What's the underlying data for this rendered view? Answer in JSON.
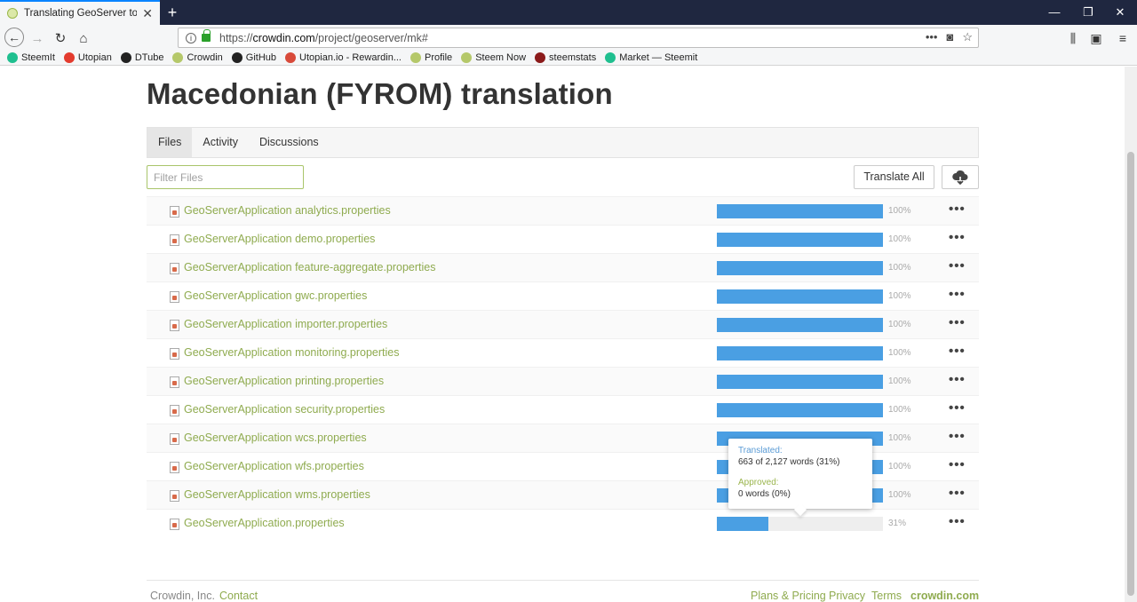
{
  "browser": {
    "tab_title": "Translating GeoServer to Maced",
    "url_domain": "crowdin.com",
    "url_path": "/project/geoserver/mk#",
    "url_prefix": "https://",
    "bookmarks": [
      {
        "label": "SteemIt",
        "color": "#1fbf8f"
      },
      {
        "label": "Utopian",
        "color": "#e33b2e"
      },
      {
        "label": "DTube",
        "color": "#222222"
      },
      {
        "label": "Crowdin",
        "color": "#b5c86a"
      },
      {
        "label": "GitHub",
        "color": "#222222"
      },
      {
        "label": "Utopian.io - Rewardin...",
        "color": "#d84a3a"
      },
      {
        "label": "Profile",
        "color": "#b5c86a"
      },
      {
        "label": "Steem Now",
        "color": "#b5c86a"
      },
      {
        "label": "steemstats",
        "color": "#8b1a1a"
      },
      {
        "label": "Market — Steemit",
        "color": "#1fbf8f"
      }
    ]
  },
  "page": {
    "title": "Macedonian (FYROM) translation",
    "tabs": [
      "Files",
      "Activity",
      "Discussions"
    ],
    "filter_placeholder": "Filter Files",
    "translate_all": "Translate All",
    "files": [
      {
        "name": "GeoServerApplication analytics.properties",
        "progress": 100,
        "pct": "100%"
      },
      {
        "name": "GeoServerApplication demo.properties",
        "progress": 100,
        "pct": "100%"
      },
      {
        "name": "GeoServerApplication feature-aggregate.properties",
        "progress": 100,
        "pct": "100%"
      },
      {
        "name": "GeoServerApplication gwc.properties",
        "progress": 100,
        "pct": "100%"
      },
      {
        "name": "GeoServerApplication importer.properties",
        "progress": 100,
        "pct": "100%"
      },
      {
        "name": "GeoServerApplication monitoring.properties",
        "progress": 100,
        "pct": "100%"
      },
      {
        "name": "GeoServerApplication printing.properties",
        "progress": 100,
        "pct": "100%"
      },
      {
        "name": "GeoServerApplication security.properties",
        "progress": 100,
        "pct": "100%"
      },
      {
        "name": "GeoServerApplication wcs.properties",
        "progress": 100,
        "pct": "100%"
      },
      {
        "name": "GeoServerApplication wfs.properties",
        "progress": 100,
        "pct": "100%"
      },
      {
        "name": "GeoServerApplication wms.properties",
        "progress": 100,
        "pct": "100%"
      },
      {
        "name": "GeoServerApplication.properties",
        "progress": 31,
        "pct": "31%"
      }
    ],
    "tooltip": {
      "translated_label": "Translated:",
      "translated_value": "663 of 2,127 words (31%)",
      "approved_label": "Approved:",
      "approved_value": "0 words (0%)"
    }
  },
  "footer": {
    "company": "Crowdin, Inc.",
    "contact": "Contact",
    "plans": "Plans & Pricing",
    "privacy": "Privacy",
    "terms": "Terms",
    "brand": "crowdin.com"
  }
}
